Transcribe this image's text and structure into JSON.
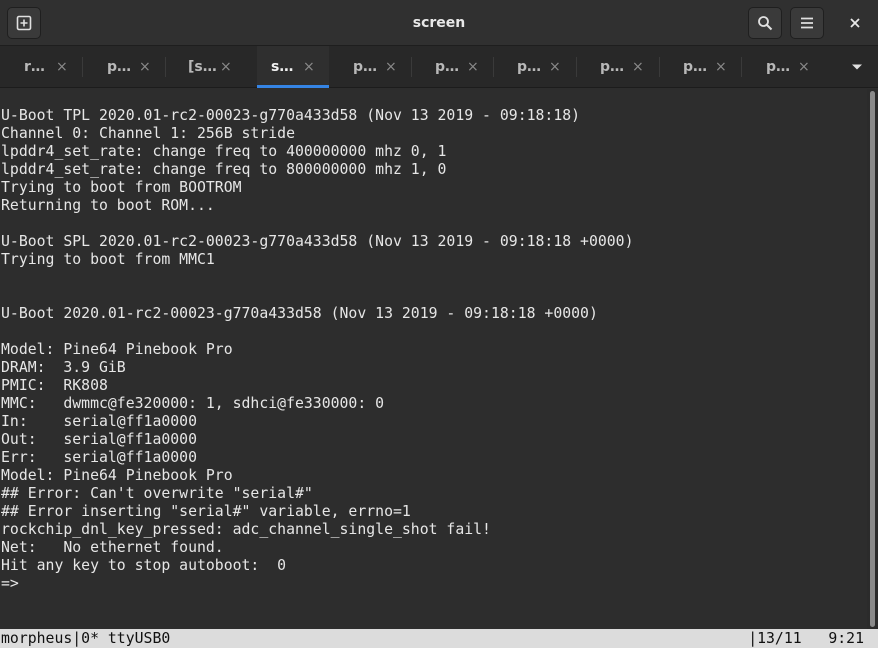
{
  "window": {
    "title": "screen"
  },
  "tabs": [
    {
      "label": "r…",
      "close": "×",
      "active": false
    },
    {
      "label": "p…",
      "close": "×",
      "active": false
    },
    {
      "label": "[s…",
      "close": "×",
      "active": false
    },
    {
      "label": "s…",
      "close": "×",
      "active": true
    },
    {
      "label": "p…",
      "close": "×",
      "active": false
    },
    {
      "label": "p…",
      "close": "×",
      "active": false
    },
    {
      "label": "p…",
      "close": "×",
      "active": false
    },
    {
      "label": "p…",
      "close": "×",
      "active": false
    },
    {
      "label": "p…",
      "close": "×",
      "active": false
    },
    {
      "label": "p…",
      "close": "×",
      "active": false
    }
  ],
  "terminal": {
    "lines": [
      "U-Boot TPL 2020.01-rc2-00023-g770a433d58 (Nov 13 2019 - 09:18:18)",
      "Channel 0: Channel 1: 256B stride",
      "lpddr4_set_rate: change freq to 400000000 mhz 0, 1",
      "lpddr4_set_rate: change freq to 800000000 mhz 1, 0",
      "Trying to boot from BOOTROM",
      "Returning to boot ROM...",
      "",
      "U-Boot SPL 2020.01-rc2-00023-g770a433d58 (Nov 13 2019 - 09:18:18 +0000)",
      "Trying to boot from MMC1",
      "",
      "",
      "U-Boot 2020.01-rc2-00023-g770a433d58 (Nov 13 2019 - 09:18:18 +0000)",
      "",
      "Model: Pine64 Pinebook Pro",
      "DRAM:  3.9 GiB",
      "PMIC:  RK808",
      "MMC:   dwmmc@fe320000: 1, sdhci@fe330000: 0",
      "In:    serial@ff1a0000",
      "Out:   serial@ff1a0000",
      "Err:   serial@ff1a0000",
      "Model: Pine64 Pinebook Pro",
      "## Error: Can't overwrite \"serial#\"",
      "## Error inserting \"serial#\" variable, errno=1",
      "rockchip_dnl_key_pressed: adc_channel_single_shot fail!",
      "Net:   No ethernet found.",
      "Hit any key to stop autoboot:  0",
      "=>"
    ]
  },
  "statusbar": {
    "left": "morpheus|0* ttyUSB0",
    "right": "|13/11   9:21"
  },
  "icons": {
    "new_tab": "new-tab-icon",
    "search": "search-icon",
    "menu": "hamburger-menu-icon",
    "close": "close-icon",
    "tabs_dropdown": "chevron-down-icon"
  }
}
